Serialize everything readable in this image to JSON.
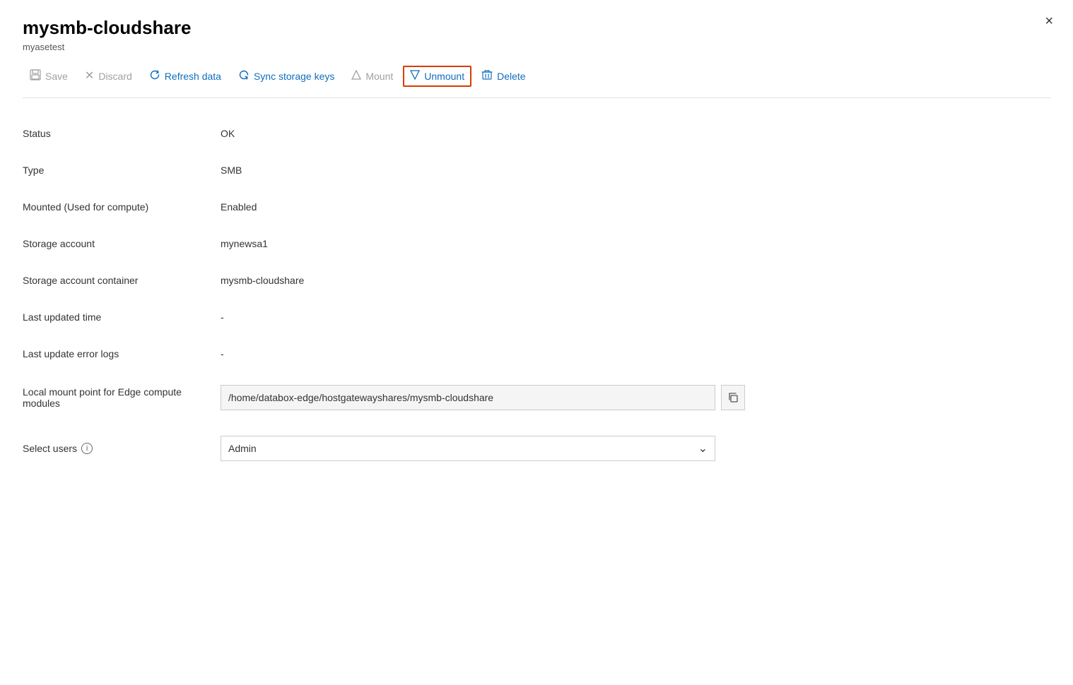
{
  "panel": {
    "title": "mysmb-cloudshare",
    "subtitle": "myasetest",
    "close_label": "×"
  },
  "toolbar": {
    "save_label": "Save",
    "discard_label": "Discard",
    "refresh_label": "Refresh data",
    "sync_label": "Sync storage keys",
    "mount_label": "Mount",
    "unmount_label": "Unmount",
    "delete_label": "Delete"
  },
  "fields": [
    {
      "label": "Status",
      "value": "OK"
    },
    {
      "label": "Type",
      "value": "SMB"
    },
    {
      "label": "Mounted (Used for compute)",
      "value": "Enabled"
    },
    {
      "label": "Storage account",
      "value": "mynewsa1"
    },
    {
      "label": "Storage account container",
      "value": "mysmb-cloudshare"
    },
    {
      "label": "Last updated time",
      "value": "-"
    },
    {
      "label": "Last update error logs",
      "value": "-"
    }
  ],
  "local_mount": {
    "label": "Local mount point for Edge compute modules",
    "value": "/home/databox-edge/hostgatewayshares/mysmb-cloudshare",
    "copy_tooltip": "Copy"
  },
  "select_users": {
    "label": "Select users",
    "value": "Admin"
  },
  "icons": {
    "save": "💾",
    "discard": "✕",
    "refresh": "↺",
    "sync": "↺",
    "mount": "△",
    "unmount": "▽",
    "delete": "🗑",
    "copy": "⧉",
    "info": "i",
    "chevron": "∨"
  }
}
